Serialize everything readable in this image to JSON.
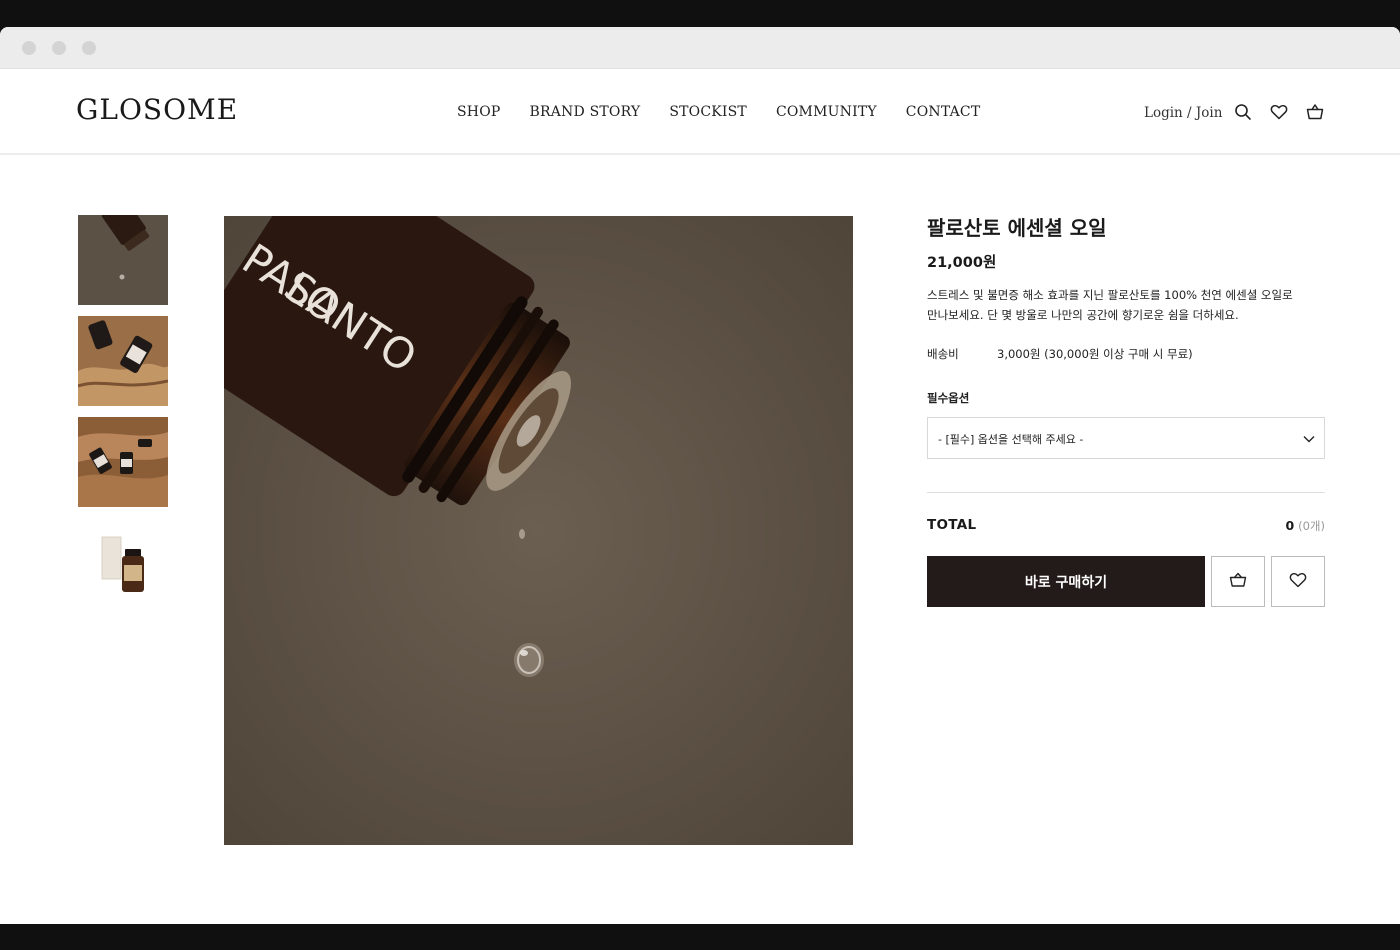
{
  "header": {
    "logo": "GLOSOME",
    "nav": [
      "SHOP",
      "BRAND STORY",
      "STOCKIST",
      "COMMUNITY",
      "CONTACT"
    ],
    "login_label": "Login / Join",
    "icons": [
      "search-icon",
      "heart-icon",
      "cart-icon"
    ]
  },
  "gallery": {
    "thumbnail_count": 4,
    "main_image_caption": "PALO SANTO"
  },
  "product": {
    "name": "팔로산토 에센셜 오일",
    "price": "21,000원",
    "description_line1": "스트레스 및 불면증 해소 효과를 지닌 팔로산토를 100% 천연 에센셜 오일로",
    "description_line2": "만나보세요. 단 몇 방울로 나만의 공간에 향기로운 쉼을 더하세요.",
    "shipping_label": "배송비",
    "shipping_value": "3,000원 (30,000원 이상 구매 시 무료)",
    "option_label": "필수옵션",
    "option_placeholder": "- [필수] 옵션을 선택해 주세요 -",
    "total_label": "TOTAL",
    "total_amount": "0",
    "total_count": "(0개)",
    "buy_label": "바로 구매하기"
  },
  "colors": {
    "buy_button": "#231b19",
    "page_frame": "#101010",
    "photo_background": "#5e5448"
  }
}
